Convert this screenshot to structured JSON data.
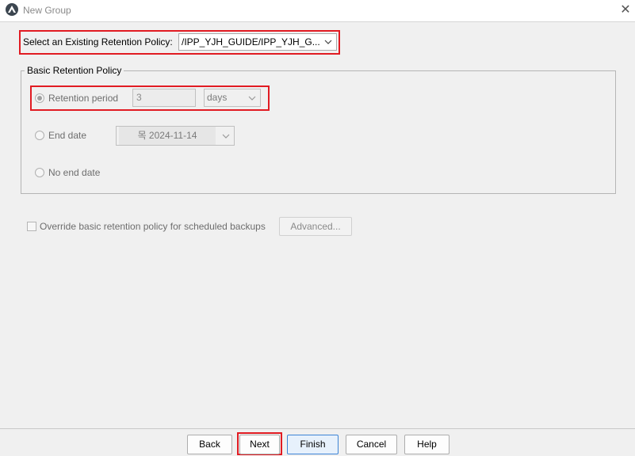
{
  "window": {
    "title": "New Group",
    "close_glyph": "✕"
  },
  "policy": {
    "label": "Select an Existing Retention Policy:",
    "selected_value": "/IPP_YJH_GUIDE/IPP_YJH_G..."
  },
  "basic_policy": {
    "group_title": "Basic Retention Policy",
    "retention_period": {
      "label": "Retention period",
      "value": "3",
      "unit": "days",
      "selected": true
    },
    "end_date": {
      "label": "End date",
      "value": "목 2024-11-14",
      "selected": false
    },
    "no_end_date": {
      "label": "No end date",
      "selected": false
    }
  },
  "override": {
    "label": "Override basic retention policy for scheduled backups",
    "checked": false,
    "advanced_label": "Advanced..."
  },
  "buttons": {
    "back": "Back",
    "next": "Next",
    "finish": "Finish",
    "cancel": "Cancel",
    "help": "Help"
  },
  "highlight_color": "#e11b22",
  "icons": {
    "app": "app-logo-icon",
    "close": "close-icon",
    "dropdown": "chevron-down-icon"
  }
}
